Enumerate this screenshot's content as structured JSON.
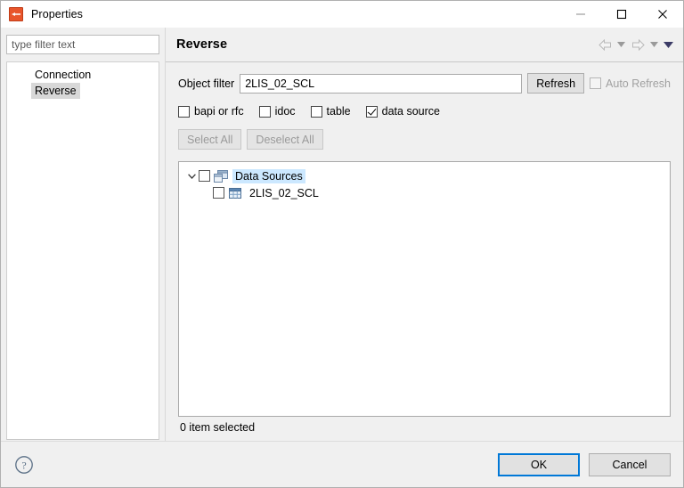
{
  "window": {
    "title": "Properties",
    "app_icon": "sap-reverse-icon",
    "controls": {
      "minimize": "minimize-icon",
      "maximize": "maximize-icon",
      "close": "close-icon"
    }
  },
  "sidebar": {
    "filter_placeholder": "type filter text",
    "filter_value": "",
    "items": [
      {
        "label": "Connection",
        "selected": false
      },
      {
        "label": "Reverse",
        "selected": true
      }
    ]
  },
  "page": {
    "title": "Reverse",
    "toolbar": {
      "back_icon": "back-arrow-icon",
      "back_menu_icon": "chevron-down-icon",
      "forward_icon": "forward-arrow-icon",
      "forward_menu_icon": "chevron-down-icon",
      "menu_icon": "chevron-down-icon"
    },
    "object_filter": {
      "label": "Object filter",
      "value": "2LIS_02_SCL",
      "placeholder": "",
      "refresh_label": "Refresh",
      "auto_refresh_label": "Auto Refresh",
      "auto_refresh_checked": false,
      "auto_refresh_enabled": false
    },
    "type_filters": [
      {
        "label": "bapi or rfc",
        "checked": false
      },
      {
        "label": "idoc",
        "checked": false
      },
      {
        "label": "table",
        "checked": false
      },
      {
        "label": "data source",
        "checked": true
      }
    ],
    "selection_buttons": {
      "select_all": "Select All",
      "deselect_all": "Deselect All",
      "enabled": false
    },
    "tree": {
      "root": {
        "label": "Data Sources",
        "icon": "data-source-folder-icon",
        "expanded": true,
        "checked": false,
        "highlighted": true
      },
      "children": [
        {
          "label": "2LIS_02_SCL",
          "icon": "table-grid-icon",
          "checked": false,
          "highlighted": false
        }
      ]
    },
    "status": "0 item selected"
  },
  "footer": {
    "help_icon": "help-question-icon",
    "ok_label": "OK",
    "cancel_label": "Cancel"
  },
  "colors": {
    "accent": "#0078d7",
    "tree_selection": "#cce8ff",
    "nav_selection": "#d8d8d8",
    "app_icon": "#e8552b",
    "window_bg": "#f0f0f0"
  }
}
